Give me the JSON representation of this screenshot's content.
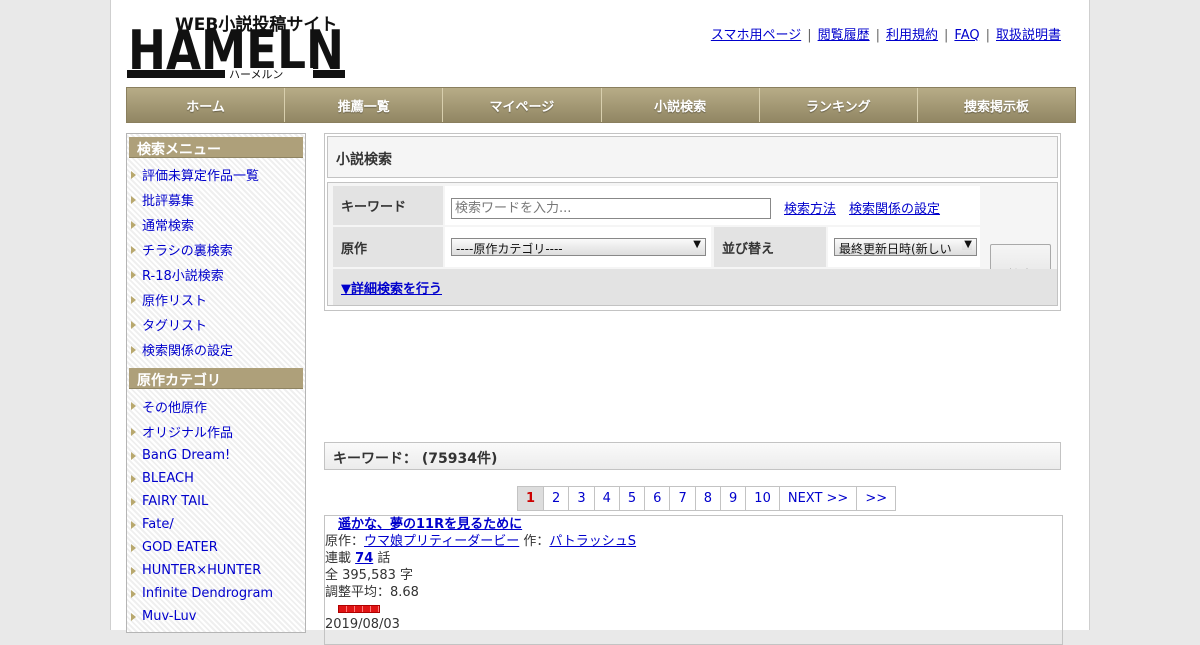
{
  "header": {
    "logo_tagline": "WEB小説投稿サイト",
    "logo_name": "HAMELN",
    "logo_kana": "ハーメルン",
    "links": [
      "スマホ用ページ",
      "閲覧履歴",
      "利用規約",
      "FAQ",
      "取扱説明書"
    ],
    "separator": "|"
  },
  "nav": [
    "ホーム",
    "推薦一覧",
    "マイページ",
    "小説検索",
    "ランキング",
    "捜索掲示板"
  ],
  "sidebar": {
    "search_menu_title": "検索メニュー",
    "search_menu": [
      "評価未算定作品一覧",
      "批評募集",
      "通常検索",
      "チラシの裏検索",
      "R-18小説検索",
      "原作リスト",
      "タグリスト",
      "検索関係の設定"
    ],
    "category_title": "原作カテゴリ",
    "categories": [
      "その他原作",
      "オリジナル作品",
      "BanG Dream!",
      "BLEACH",
      "FAIRY TAIL",
      "Fate/",
      "GOD EATER",
      "HUNTER×HUNTER",
      "Infinite Dendrogram",
      "Muv-Luv"
    ]
  },
  "search": {
    "title": "小説検索",
    "keyword_label": "キーワード",
    "keyword_placeholder": "検索ワードを入力...",
    "keyword_value": "",
    "method_link": "検索方法",
    "settings_link": "検索関係の設定",
    "original_label": "原作",
    "original_selected": "----原作カテゴリ----",
    "sort_label": "並び替え",
    "sort_selected": "最終更新日時(新しい",
    "search_button": "検索",
    "detail_link": "▼詳細検索を行う"
  },
  "results": {
    "header": "キーワード： (75934件)",
    "pages": [
      "1",
      "2",
      "3",
      "4",
      "5",
      "6",
      "7",
      "8",
      "9",
      "10",
      "NEXT >>",
      ">>"
    ],
    "current_page": "1"
  },
  "result_item": {
    "title": "遥かな、夢の11Rを見るために",
    "original_label": "原作：",
    "original": "ウマ娘プリティーダービー",
    "author_label": "作：",
    "author": "パトラッシュS",
    "serial_prefix": "連載",
    "episodes": "74",
    "serial_suffix": "話",
    "chars": "全 395,583 字",
    "rating": "調整平均：8.68",
    "rating_color": "#e01414",
    "date": "2019/08/03"
  }
}
